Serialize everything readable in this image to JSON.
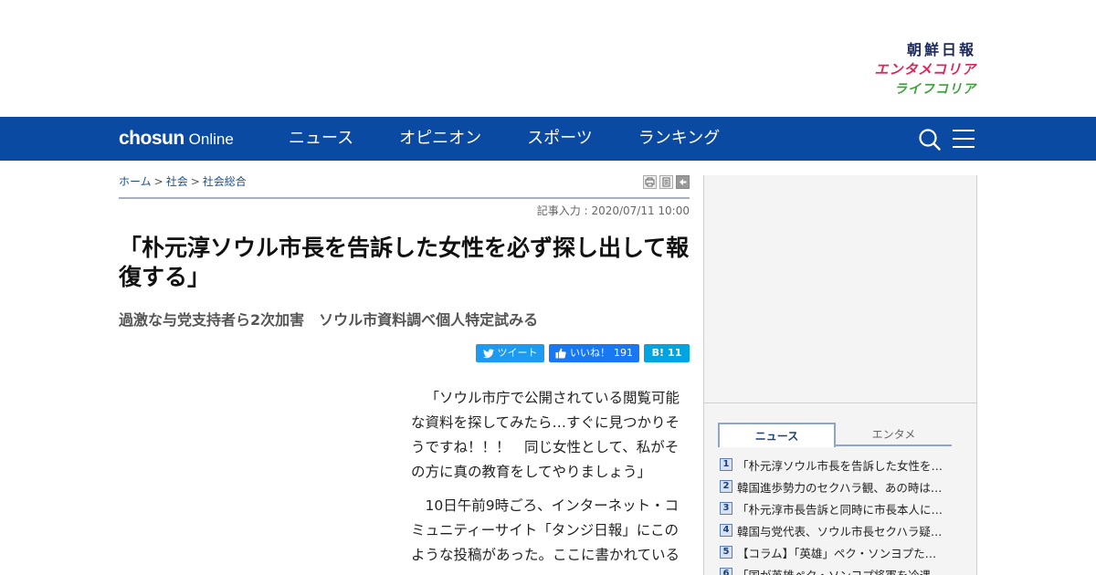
{
  "header": {
    "brands": [
      {
        "label": "朝鮮日報",
        "color": "#1c2a5a"
      },
      {
        "label": "エンタメコリア",
        "color": "#d9275a"
      },
      {
        "label": "ライフコリア",
        "color": "#3e9f3c"
      }
    ]
  },
  "nav": {
    "background": "#0b4aa2",
    "logo_bold": "chosun",
    "logo_light": "Online",
    "items": [
      "ニュース",
      "オピニオン",
      "スポーツ",
      "ランキング"
    ],
    "search_icon": "search-icon",
    "menu_icon": "hamburger-menu-icon"
  },
  "breadcrumb": {
    "items": [
      "ホーム",
      "社会",
      "社会総合"
    ],
    "separator": ">"
  },
  "tools": [
    "print-icon",
    "text-size-icon",
    "back-arrow-icon"
  ],
  "article": {
    "date": "記事入力 : 2020/07/11 10:00",
    "headline": "「朴元淳ソウル市長を告訴した女性を必ず探し出して報復する」",
    "subhead": "過激な与党支持者ら2次加害　ソウル市資料調べ個人特定試みる",
    "paragraphs": [
      "「ソウル市庁で公開されている閲覧可能な資料を探してみたら…すぐに見つかりそうですね！！！　同じ女性として、私がその方に真の教育をしてやりましょう」",
      "10日午前9時ごろ、インターネット・コミュニティーサイト「タンジ日報」にこのような投稿があった。ここに書かれている"
    ]
  },
  "share": {
    "tweet_label": "ツイート",
    "like_label": "いいね！",
    "like_count": "191",
    "hatena_label": "B!",
    "hatena_count": "11"
  },
  "sidebar": {
    "tabs": [
      "ニュース",
      "エンタメ"
    ],
    "ranking": [
      {
        "rank": "1",
        "title": "「朴元淳ソウル市長を告訴した女性を…"
      },
      {
        "rank": "2",
        "title": "韓国進歩勢力のセクハラ観、あの時は…"
      },
      {
        "rank": "3",
        "title": "「朴元淳市長告訴と同時に市長本人に…"
      },
      {
        "rank": "4",
        "title": "韓国与党代表、ソウル市長セクハラ疑…"
      },
      {
        "rank": "5",
        "title": "【コラム】「英雄」ペク・ソンヨプた…"
      },
      {
        "rank": "6",
        "title": "「国が英雄ペク・ソンヨプ将軍を冷遇…"
      }
    ]
  }
}
